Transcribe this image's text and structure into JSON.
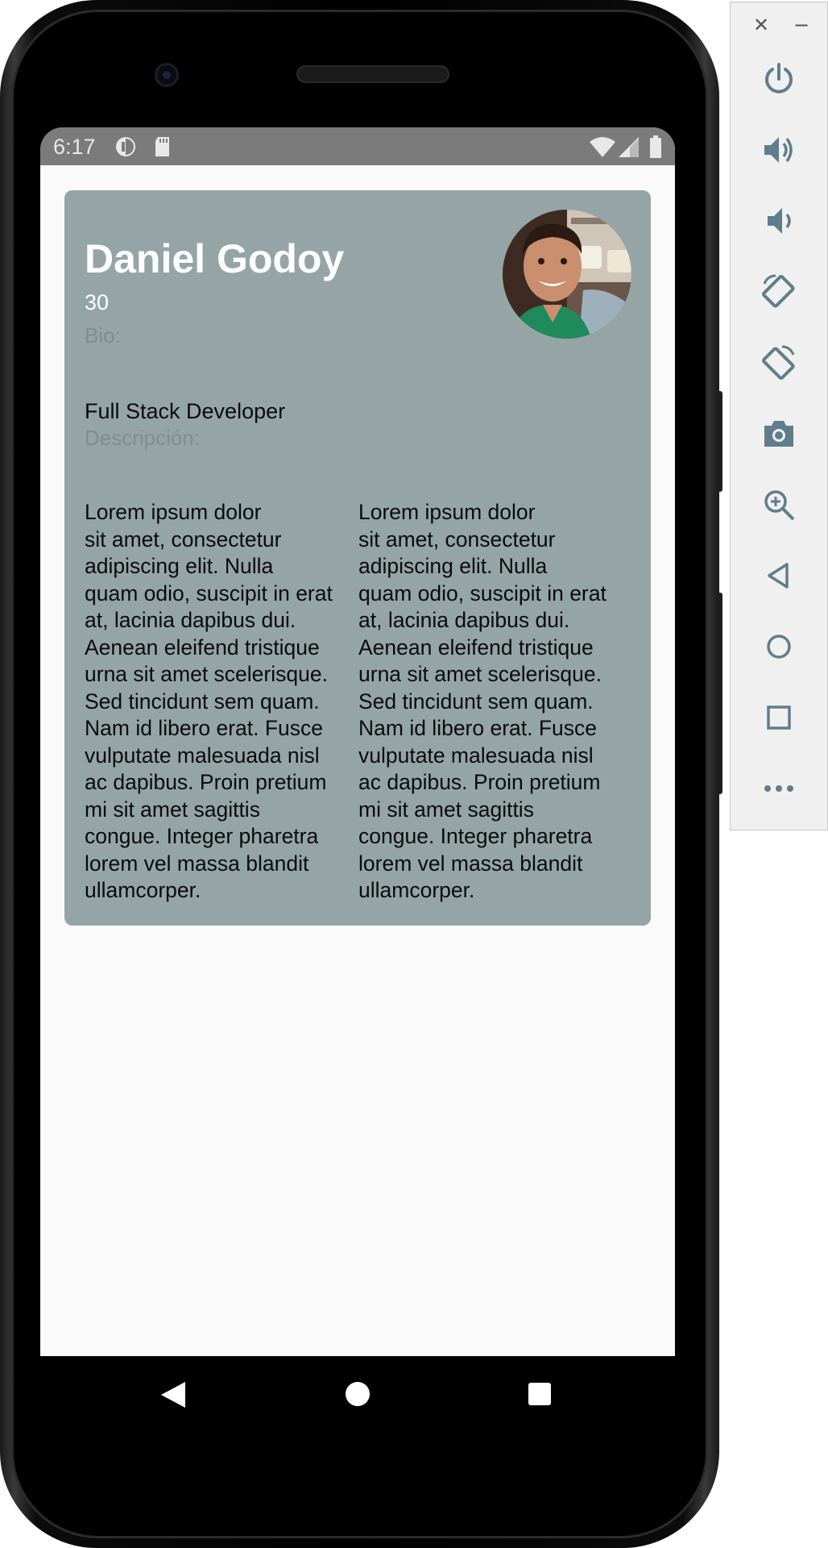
{
  "status_bar": {
    "time": "6:17"
  },
  "profile": {
    "name": "Daniel Godoy",
    "age": "30",
    "bio_label": "Bio:",
    "bio": "Full Stack Developer",
    "description_label": "Descripción:",
    "description_col1": "Lorem ipsum dolor\nsit amet, consectetur\nadipiscing elit. Nulla\nquam odio, suscipit in erat\nat, lacinia dapibus dui.\nAenean eleifend tristique\nurna sit amet scelerisque.\nSed tincidunt sem quam.\nNam id libero erat. Fusce\nvulputate malesuada nisl\nac dapibus. Proin pretium\nmi sit amet sagittis\ncongue. Integer pharetra\nlorem vel massa blandit\nullamcorper.",
    "description_col2": "Lorem ipsum dolor\nsit amet, consectetur\nadipiscing elit. Nulla\nquam odio, suscipit in erat\nat, lacinia dapibus dui.\nAenean eleifend tristique\nurna sit amet scelerisque.\nSed tincidunt sem quam.\nNam id libero erat. Fusce\nvulputate malesuada nisl\nac dapibus. Proin pretium\nmi sit amet sagittis\ncongue. Integer pharetra\nlorem vel massa blandit\nullamcorper."
  },
  "colors": {
    "card_background": "#95a5a6",
    "screen_background": "#fafafa",
    "status_bar": "#7b7b7b",
    "label_text": "#808c8d",
    "emulator_icon": "#607d8b"
  },
  "emulator_toolbar": {
    "window_controls": [
      "close-icon",
      "minimize-icon"
    ],
    "buttons": [
      "power-icon",
      "volume-up-icon",
      "volume-down-icon",
      "rotate-left-icon",
      "rotate-right-icon",
      "camera-icon",
      "zoom-icon",
      "back-icon",
      "home-icon",
      "overview-icon",
      "more-icon"
    ],
    "close_glyph": "✕",
    "minimize_glyph": "−"
  },
  "nav_bar": {
    "buttons": [
      "back-icon",
      "home-icon",
      "recents-icon"
    ]
  }
}
